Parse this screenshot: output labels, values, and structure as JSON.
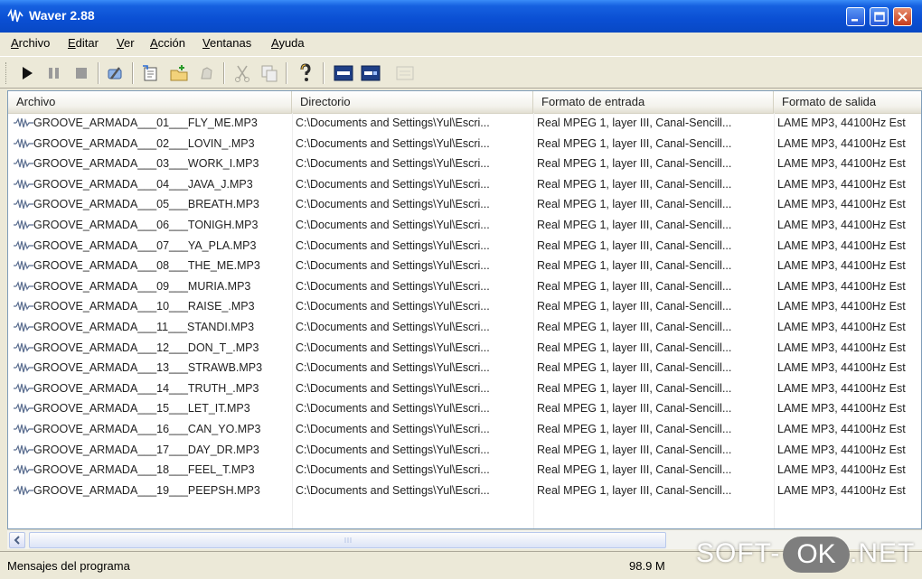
{
  "window": {
    "title": "Waver 2.88"
  },
  "menu": [
    {
      "label": "Archivo"
    },
    {
      "label": "Editar"
    },
    {
      "label": "Ver"
    },
    {
      "label": "Acción"
    },
    {
      "label": "Ventanas"
    },
    {
      "label": "Ayuda"
    }
  ],
  "toolbar": {
    "icons": [
      "play-icon",
      "pause-icon",
      "stop-icon",
      "settings-wrench-icon",
      "add-files-icon",
      "add-folder-icon",
      "clear-icon",
      "cut-icon",
      "copy-icon",
      "help-icon",
      "view-list-icon",
      "view-details-icon",
      "view-disabled-icon"
    ]
  },
  "table": {
    "columns": [
      "Archivo",
      "Directorio",
      "Formato de entrada",
      "Formato de salida"
    ],
    "rows": [
      {
        "file": "GROOVE_ARMADA___01___FLY_ME.MP3",
        "dir": "C:\\Documents and Settings\\Yul\\Escri...",
        "in": "Real MPEG 1, layer III, Canal-Sencill...",
        "out": "LAME MP3, 44100Hz Est"
      },
      {
        "file": "GROOVE_ARMADA___02___LOVIN_.MP3",
        "dir": "C:\\Documents and Settings\\Yul\\Escri...",
        "in": "Real MPEG 1, layer III, Canal-Sencill...",
        "out": "LAME MP3, 44100Hz Est"
      },
      {
        "file": "GROOVE_ARMADA___03___WORK_I.MP3",
        "dir": "C:\\Documents and Settings\\Yul\\Escri...",
        "in": "Real MPEG 1, layer III, Canal-Sencill...",
        "out": "LAME MP3, 44100Hz Est"
      },
      {
        "file": "GROOVE_ARMADA___04___JAVA_J.MP3",
        "dir": "C:\\Documents and Settings\\Yul\\Escri...",
        "in": "Real MPEG 1, layer III, Canal-Sencill...",
        "out": "LAME MP3, 44100Hz Est"
      },
      {
        "file": "GROOVE_ARMADA___05___BREATH.MP3",
        "dir": "C:\\Documents and Settings\\Yul\\Escri...",
        "in": "Real MPEG 1, layer III, Canal-Sencill...",
        "out": "LAME MP3, 44100Hz Est"
      },
      {
        "file": "GROOVE_ARMADA___06___TONIGH.MP3",
        "dir": "C:\\Documents and Settings\\Yul\\Escri...",
        "in": "Real MPEG 1, layer III, Canal-Sencill...",
        "out": "LAME MP3, 44100Hz Est"
      },
      {
        "file": "GROOVE_ARMADA___07___YA_PLA.MP3",
        "dir": "C:\\Documents and Settings\\Yul\\Escri...",
        "in": "Real MPEG 1, layer III, Canal-Sencill...",
        "out": "LAME MP3, 44100Hz Est"
      },
      {
        "file": "GROOVE_ARMADA___08___THE_ME.MP3",
        "dir": "C:\\Documents and Settings\\Yul\\Escri...",
        "in": "Real MPEG 1, layer III, Canal-Sencill...",
        "out": "LAME MP3, 44100Hz Est"
      },
      {
        "file": "GROOVE_ARMADA___09___MURIA.MP3",
        "dir": "C:\\Documents and Settings\\Yul\\Escri...",
        "in": "Real MPEG 1, layer III, Canal-Sencill...",
        "out": "LAME MP3, 44100Hz Est"
      },
      {
        "file": "GROOVE_ARMADA___10___RAISE_.MP3",
        "dir": "C:\\Documents and Settings\\Yul\\Escri...",
        "in": "Real MPEG 1, layer III, Canal-Sencill...",
        "out": "LAME MP3, 44100Hz Est"
      },
      {
        "file": "GROOVE_ARMADA___11___STANDI.MP3",
        "dir": "C:\\Documents and Settings\\Yul\\Escri...",
        "in": "Real MPEG 1, layer III, Canal-Sencill...",
        "out": "LAME MP3, 44100Hz Est"
      },
      {
        "file": "GROOVE_ARMADA___12___DON_T_.MP3",
        "dir": "C:\\Documents and Settings\\Yul\\Escri...",
        "in": "Real MPEG 1, layer III, Canal-Sencill...",
        "out": "LAME MP3, 44100Hz Est"
      },
      {
        "file": "GROOVE_ARMADA___13___STRAWB.MP3",
        "dir": "C:\\Documents and Settings\\Yul\\Escri...",
        "in": "Real MPEG 1, layer III, Canal-Sencill...",
        "out": "LAME MP3, 44100Hz Est"
      },
      {
        "file": "GROOVE_ARMADA___14___TRUTH_.MP3",
        "dir": "C:\\Documents and Settings\\Yul\\Escri...",
        "in": "Real MPEG 1, layer III, Canal-Sencill...",
        "out": "LAME MP3, 44100Hz Est"
      },
      {
        "file": "GROOVE_ARMADA___15___LET_IT.MP3",
        "dir": "C:\\Documents and Settings\\Yul\\Escri...",
        "in": "Real MPEG 1, layer III, Canal-Sencill...",
        "out": "LAME MP3, 44100Hz Est"
      },
      {
        "file": "GROOVE_ARMADA___16___CAN_YO.MP3",
        "dir": "C:\\Documents and Settings\\Yul\\Escri...",
        "in": "Real MPEG 1, layer III, Canal-Sencill...",
        "out": "LAME MP3, 44100Hz Est"
      },
      {
        "file": "GROOVE_ARMADA___17___DAY_DR.MP3",
        "dir": "C:\\Documents and Settings\\Yul\\Escri...",
        "in": "Real MPEG 1, layer III, Canal-Sencill...",
        "out": "LAME MP3, 44100Hz Est"
      },
      {
        "file": "GROOVE_ARMADA___18___FEEL_T.MP3",
        "dir": "C:\\Documents and Settings\\Yul\\Escri...",
        "in": "Real MPEG 1, layer III, Canal-Sencill...",
        "out": "LAME MP3, 44100Hz Est"
      },
      {
        "file": "GROOVE_ARMADA___19___PEEPSH.MP3",
        "dir": "C:\\Documents and Settings\\Yul\\Escri...",
        "in": "Real MPEG 1, layer III, Canal-Sencill...",
        "out": "LAME MP3, 44100Hz Est"
      }
    ]
  },
  "status": {
    "message": "Mensajes del programa",
    "size": "98.9 M"
  },
  "watermark": {
    "left": "SOFT-",
    "pill": "OK",
    "right": ".NET"
  },
  "colors": {
    "titlebar": "#0A4FD3",
    "chrome": "#ECE9D8",
    "close": "#C63C1E"
  }
}
